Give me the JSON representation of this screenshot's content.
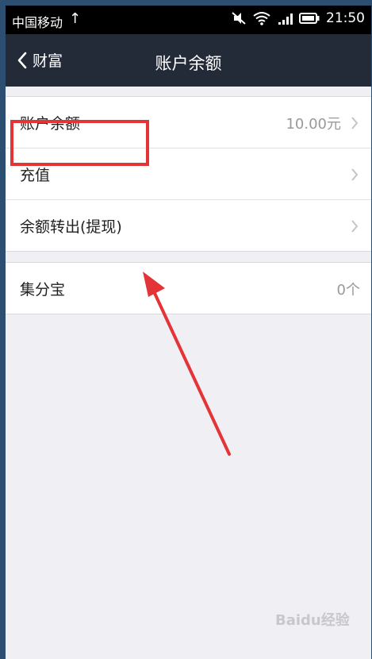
{
  "status_bar": {
    "carrier": "中国移动",
    "upload_icon": "upload-arrow-icon",
    "icons": [
      "mute-icon",
      "wifi-icon",
      "signal-icon",
      "battery-icon"
    ],
    "time": "21:50"
  },
  "nav": {
    "back_label": "财富",
    "title": "账户余额"
  },
  "rows": {
    "balance": {
      "label": "账户余额",
      "value": "10.00元"
    },
    "recharge": {
      "label": "充值"
    },
    "withdraw": {
      "label": "余额转出(提现)"
    },
    "jifenbao": {
      "label": "集分宝",
      "value": "0个"
    }
  },
  "colors": {
    "navbar": "#232a38",
    "highlight": "#e33437",
    "background": "#efeff4"
  },
  "watermark": "Baidu经验"
}
